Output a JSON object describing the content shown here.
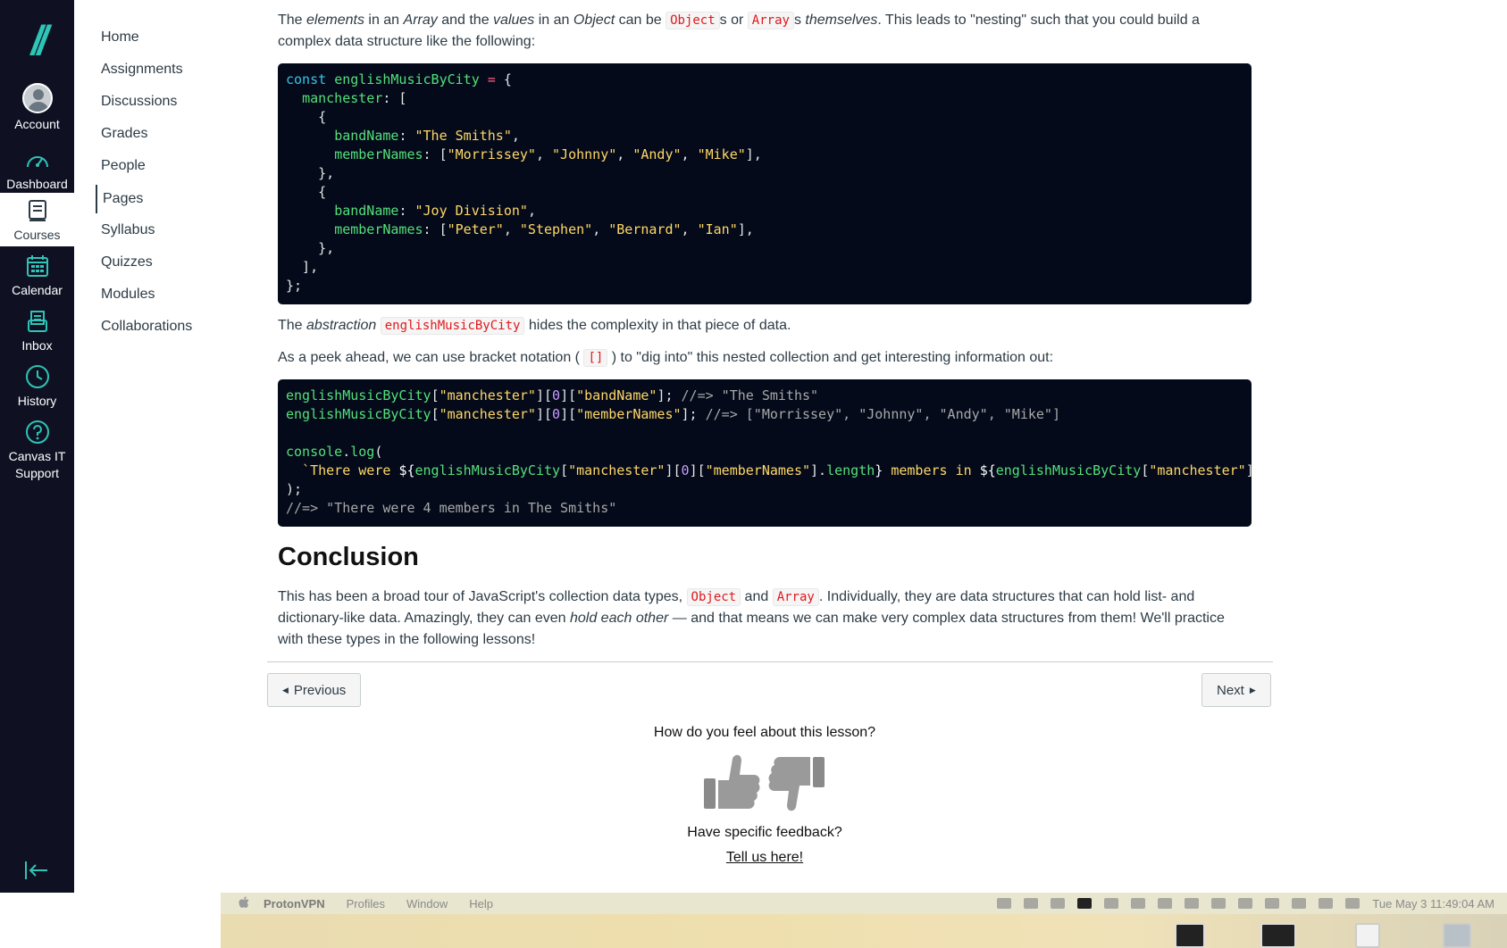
{
  "global_nav": {
    "logo_text": "//",
    "items": [
      {
        "label": "Account",
        "icon": "account-avatar"
      },
      {
        "label": "Dashboard",
        "icon": "dashboard-icon"
      },
      {
        "label": "Courses",
        "icon": "courses-icon"
      },
      {
        "label": "Calendar",
        "icon": "calendar-icon"
      },
      {
        "label": "Inbox",
        "icon": "inbox-icon"
      },
      {
        "label": "History",
        "icon": "history-icon"
      },
      {
        "label": "Canvas IT Support",
        "icon": "help-icon"
      }
    ],
    "accent_color": "#2ec4b6"
  },
  "course_nav": {
    "items": [
      "Home",
      "Assignments",
      "Discussions",
      "Grades",
      "People",
      "Pages",
      "Syllabus",
      "Quizzes",
      "Modules",
      "Collaborations"
    ],
    "active": "Pages"
  },
  "content": {
    "intro": {
      "t1": "The ",
      "elements": "elements",
      "t2": " in an ",
      "array": "Array",
      "t3": " and the ",
      "values": "values",
      "t4": " in an ",
      "object": "Object",
      "t5": " can be ",
      "code_object": "Object",
      "t6": "s or ",
      "code_array": "Array",
      "t7": "s ",
      "themselves": "themselves",
      "t8": ". This leads to \"nesting\" such that you could build a complex data structure like the following:"
    },
    "abstraction": {
      "t1": "The ",
      "em": "abstraction",
      "code": "englishMusicByCity",
      "t2": " hides the complexity in that piece of data."
    },
    "peek": {
      "t1": "As a peek ahead, we can use bracket notation ( ",
      "code": "[]",
      "t2": " ) to \"dig into\" this nested collection and get interesting information out:"
    },
    "conclusion_heading": "Conclusion",
    "conclusion": {
      "t1": "This has been a broad tour of JavaScript's collection data types, ",
      "code_object": "Object",
      "t2": " and ",
      "code_array": "Array",
      "t3": ". Individually, they are data structures that can hold list- and dictionary-like data. Amazingly, they can even ",
      "em": "hold each other",
      "t4": " — and that means we can make very complex data structures from them! We'll practice with these types in the following lessons!"
    }
  },
  "pager": {
    "previous": "Previous",
    "next": "Next"
  },
  "feedback": {
    "question": "How do you feel about this lesson?",
    "specific": "Have specific feedback?",
    "link": "Tell us here!"
  },
  "os_menubar": {
    "apple_icon": "apple-icon",
    "app": "ProtonVPN",
    "menus": [
      "Profiles",
      "Window",
      "Help"
    ],
    "clock": "Tue May 3  11:49:04 AM"
  }
}
